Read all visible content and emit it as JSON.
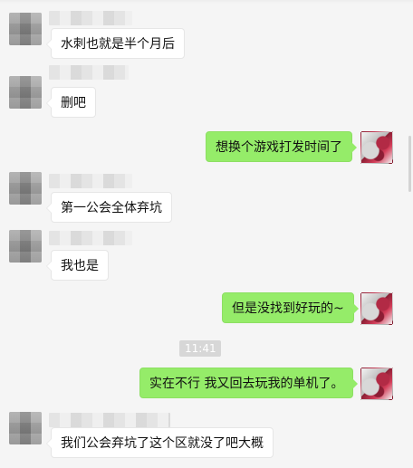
{
  "messages": [
    {
      "side": "in",
      "text": "水刺也就是半个月后"
    },
    {
      "side": "in",
      "text": "删吧"
    },
    {
      "side": "out",
      "text": "想换个游戏打发时间了"
    },
    {
      "side": "in",
      "text": "第一公会全体弃坑"
    },
    {
      "side": "in",
      "text": "我也是"
    },
    {
      "side": "out",
      "text": "但是没找到好玩的~"
    },
    {
      "side": "out",
      "text": "实在不行 我又回去玩我的单机了。"
    },
    {
      "side": "in",
      "text": "我们公会弃坑了这个区就没了吧大概"
    }
  ],
  "timestamp": "11:41",
  "colors": {
    "background": "#f5f5f5",
    "incoming_bubble": "#ffffff",
    "outgoing_bubble": "#95ec69",
    "time_chip": "#d7d7d7"
  }
}
